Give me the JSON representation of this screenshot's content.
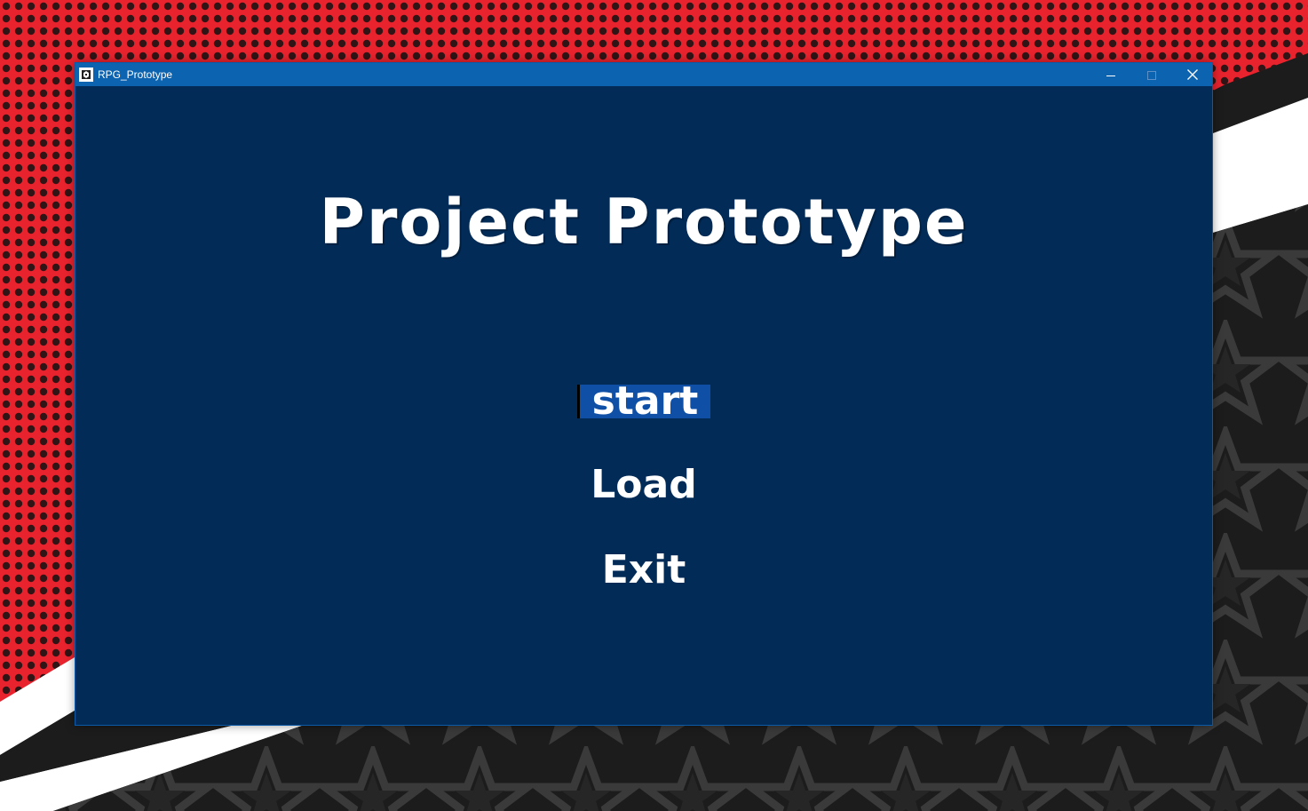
{
  "window": {
    "title": "RPG_Prototype",
    "icon": "unity-icon"
  },
  "window_controls": {
    "minimize": "minimize-icon",
    "maximize": "maximize-icon",
    "close": "close-icon"
  },
  "game": {
    "title": "Project Prototype",
    "menu": {
      "start": "start",
      "load": "Load",
      "exit": "Exit"
    },
    "selected_item": "start"
  },
  "colors": {
    "game_background": "#022b57",
    "titlebar": "#0c63b0",
    "selection_highlight": "#0f4fa6",
    "text": "#ffffff",
    "wallpaper_red": "#e8232e"
  }
}
